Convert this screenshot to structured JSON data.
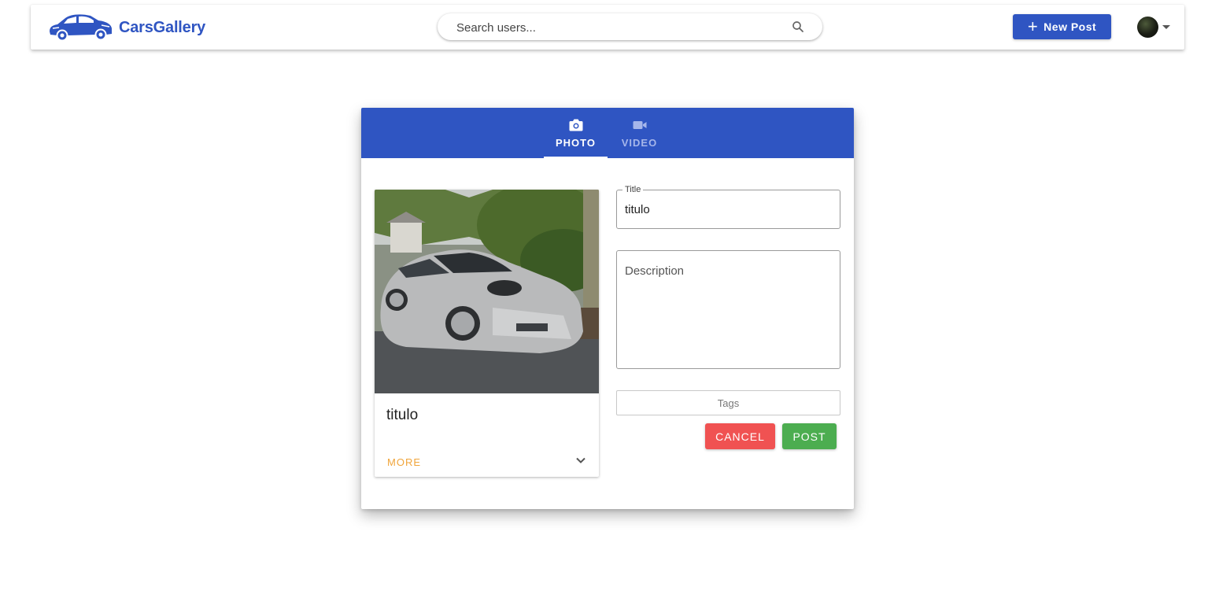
{
  "header": {
    "brand": "CarsGallery",
    "search_placeholder": "Search users...",
    "new_post_label": "New Post"
  },
  "tabs": [
    {
      "label": "PHOTO",
      "icon": "camera-icon",
      "active": true
    },
    {
      "label": "VIDEO",
      "icon": "video-camera-icon",
      "active": false
    }
  ],
  "preview": {
    "title": "titulo",
    "more_label": "MORE"
  },
  "form": {
    "title_label": "Title",
    "title_value": "titulo",
    "description_placeholder": "Description",
    "tags_placeholder": "Tags",
    "cancel_label": "CANCEL",
    "post_label": "POST"
  },
  "colors": {
    "brand": "#2f55c2",
    "more": "#f0a53b",
    "cancel": "#f05252",
    "post": "#4cad50"
  }
}
